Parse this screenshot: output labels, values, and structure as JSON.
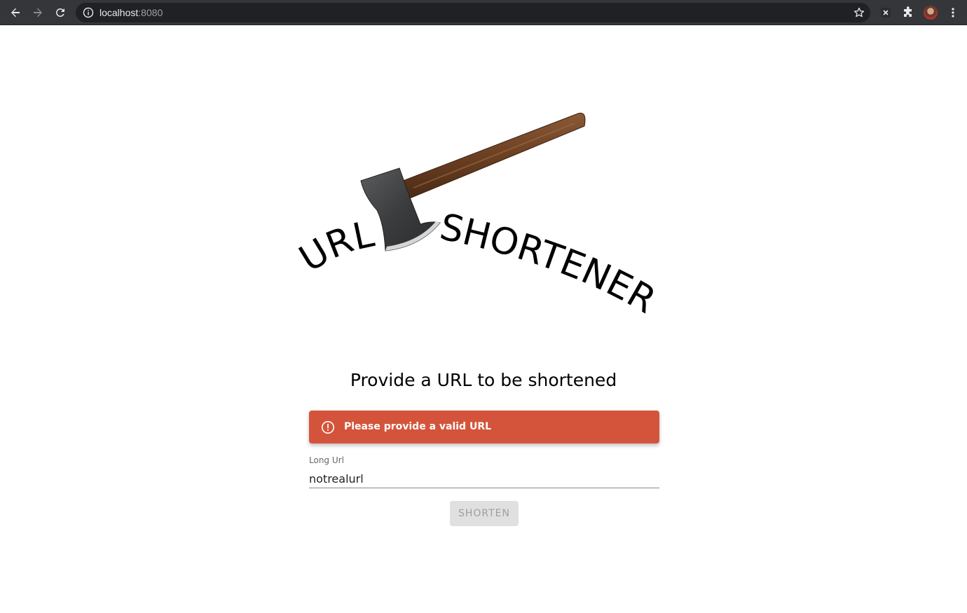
{
  "browser": {
    "url_host": "localhost",
    "url_port": ":8080"
  },
  "logo": {
    "text_left": "URL",
    "text_right": "SHORTENER"
  },
  "main": {
    "heading": "Provide a URL to be shortened",
    "alert_message": "Please provide a valid URL",
    "field_label": "Long Url",
    "field_value": "notrealurl",
    "submit_label": "SHORTEN"
  },
  "colors": {
    "alert_bg": "#d4543b",
    "button_bg": "#e0e0e0",
    "chrome_bg": "#35363a"
  },
  "icons": [
    "back-arrow-icon",
    "forward-arrow-icon",
    "reload-icon",
    "info-icon",
    "star-icon",
    "extension-x-icon",
    "puzzle-icon",
    "kebab-menu-icon",
    "alert-circle-icon",
    "axe-icon"
  ]
}
